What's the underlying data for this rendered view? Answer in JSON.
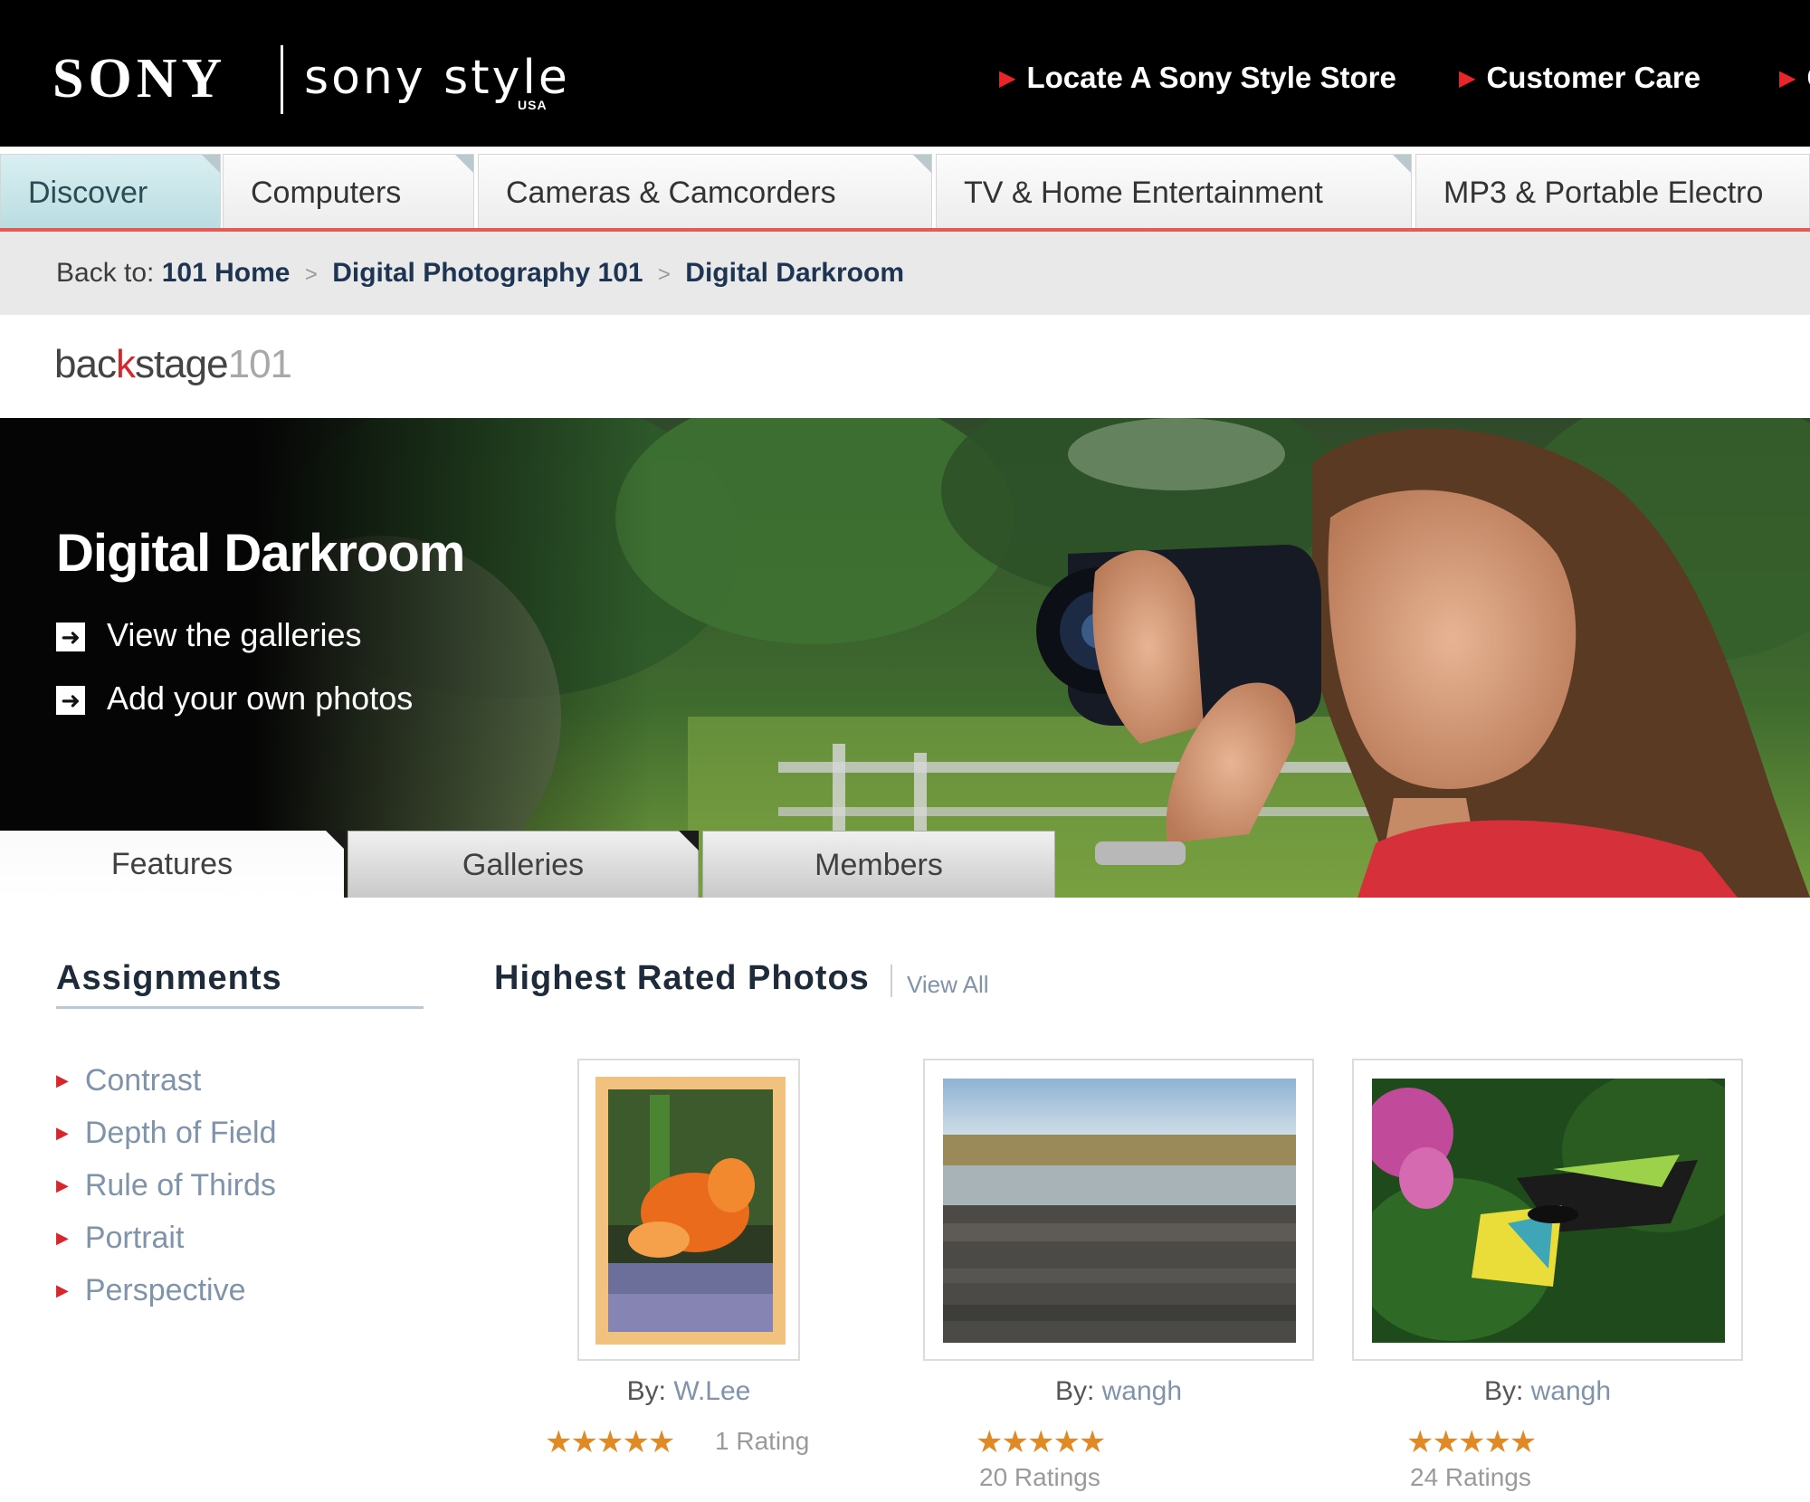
{
  "header": {
    "brand": "SONY",
    "store_brand": "sony style",
    "store_region": "USA",
    "links": [
      "Locate A Sony Style Store",
      "Customer Care",
      "C"
    ]
  },
  "nav": {
    "tabs": [
      "Discover",
      "Computers",
      "Cameras & Camcorders",
      "TV & Home Entertainment",
      "MP3 & Portable Electro"
    ],
    "active": "Discover"
  },
  "breadcrumb": {
    "prefix": "Back to:",
    "items": [
      "101 Home",
      "Digital Photography 101",
      "Digital Darkroom"
    ],
    "separator": ">"
  },
  "section_brand": {
    "part1": "bac",
    "part2": "k",
    "part3": "stage",
    "part4": "101"
  },
  "hero": {
    "title": "Digital Darkroom",
    "links": [
      "View the galleries",
      "Add your own photos"
    ],
    "tabs": [
      "Features",
      "Galleries",
      "Members"
    ],
    "active_tab": "Features"
  },
  "assignments": {
    "title": "Assignments",
    "items": [
      "Contrast",
      "Depth of Field",
      "Rule of Thirds",
      "Portrait",
      "Perspective"
    ]
  },
  "highest_rated": {
    "title": "Highest Rated Photos",
    "view_all": "View All",
    "by_label": "By:",
    "photos": [
      {
        "author": "W.Lee",
        "stars": 5,
        "ratings": "1 Rating"
      },
      {
        "author": "wangh",
        "stars": 5,
        "ratings": "20 Ratings"
      },
      {
        "author": "wangh",
        "stars": 5,
        "ratings": "24 Ratings"
      }
    ]
  },
  "colors": {
    "accent_red": "#e8262a",
    "link_blue": "#7f93aa",
    "star_orange": "#e08a26",
    "nav_active": "#c5e4e8"
  }
}
